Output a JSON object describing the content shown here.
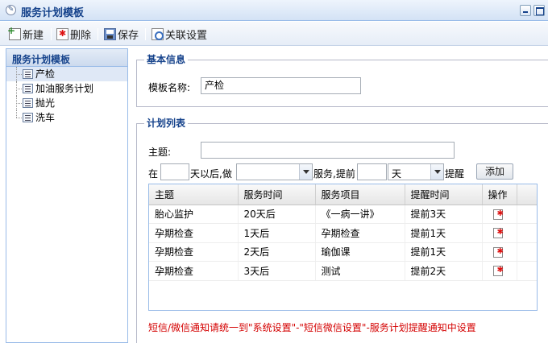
{
  "window": {
    "title": "服务计划模板"
  },
  "toolbar": {
    "new_label": "新建",
    "delete_label": "删除",
    "save_label": "保存",
    "link_label": "关联设置"
  },
  "sidebar": {
    "header": "服务计划模板",
    "items": [
      {
        "label": "产检",
        "selected": true
      },
      {
        "label": "加油服务计划"
      },
      {
        "label": "抛光"
      },
      {
        "label": "洗车"
      }
    ]
  },
  "basic_info": {
    "legend": "基本信息",
    "template_name_label": "模板名称:",
    "template_name_value": "产检"
  },
  "plan_list": {
    "legend": "计划列表",
    "subject_label": "主题:",
    "subject_value": "",
    "at_label": "在",
    "days_value": "",
    "days_after_label": "天以后,做",
    "service_value": "",
    "service_remind_label": "服务,提前",
    "remind_value": "",
    "unit_value": "天",
    "remind_label": "提醒",
    "add_button": "添加",
    "columns": [
      "主题",
      "服务时间",
      "服务项目",
      "提醒时间",
      "操作"
    ],
    "rows": [
      {
        "subject": "胎心监护",
        "time": "20天后",
        "item": "《一病一讲》",
        "remind": "提前3天"
      },
      {
        "subject": "孕期检查",
        "time": "1天后",
        "item": "孕期检查",
        "remind": "提前1天"
      },
      {
        "subject": "孕期检查",
        "time": "2天后",
        "item": "瑜伽课",
        "remind": "提前1天"
      },
      {
        "subject": "孕期检查",
        "time": "3天后",
        "item": "测试",
        "remind": "提前2天"
      }
    ]
  },
  "notice": "短信/微信通知请统一到\"系统设置\"-\"短信微信设置\"-服务计划提醒通知中设置",
  "colors": {
    "accent": "#15428b",
    "border": "#99bbe8",
    "notice": "#d40000"
  },
  "icons": [
    "app-icon",
    "minimize-icon",
    "maximize-icon",
    "new-icon",
    "delete-icon",
    "save-icon",
    "link-icon",
    "document-icon"
  ]
}
